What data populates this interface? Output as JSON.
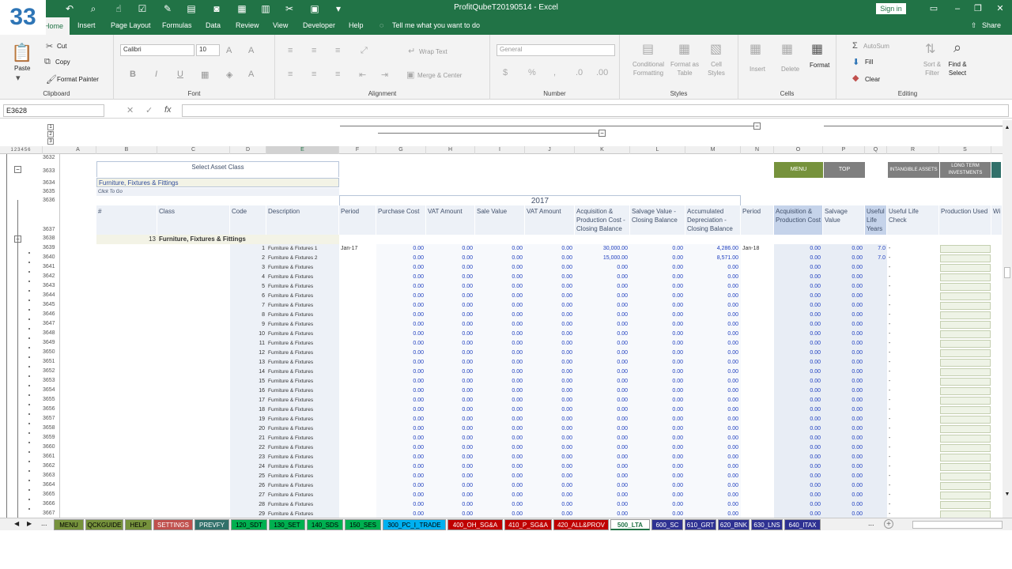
{
  "badge": "33",
  "doc_title": "ProfitQubeT20190514  -  Excel",
  "signin": "Sign in",
  "share": "Share",
  "ribbon_tabs": [
    "Home",
    "Insert",
    "Page Layout",
    "Formulas",
    "Data",
    "Review",
    "View",
    "Developer",
    "Help"
  ],
  "tell_me": "Tell me what you want to do",
  "clipboard": {
    "paste": "Paste",
    "cut": "Cut",
    "copy": "Copy",
    "format_painter": "Format Painter",
    "label": "Clipboard"
  },
  "font": {
    "name": "Calibri",
    "size": "10",
    "label": "Font"
  },
  "alignment": {
    "wrap": "Wrap Text",
    "merge": "Merge & Center",
    "label": "Alignment"
  },
  "number": {
    "format": "General",
    "label": "Number"
  },
  "styles": {
    "cond": "Conditional Formatting",
    "table": "Format as Table",
    "cell": "Cell Styles",
    "label": "Styles"
  },
  "cells": {
    "insert": "Insert",
    "delete": "Delete",
    "format": "Format",
    "label": "Cells"
  },
  "editing": {
    "autosum": "AutoSum",
    "fill": "Fill",
    "clear": "Clear",
    "sort": "Sort & Filter",
    "find": "Find & Select",
    "label": "Editing"
  },
  "namebox": "E3628",
  "fx": "fx",
  "col_headers": [
    "A",
    "B",
    "C",
    "D",
    "E",
    "F",
    "G",
    "H",
    "I",
    "J",
    "K",
    "L",
    "M",
    "N",
    "O",
    "P",
    "Q",
    "R",
    "S"
  ],
  "row_numbers": [
    "3632",
    "3633",
    "3634",
    "3635",
    "3636",
    "3637",
    "3638",
    "3639",
    "3640",
    "3641",
    "3642",
    "3643",
    "3644",
    "3645",
    "3646",
    "3647",
    "3648",
    "3649",
    "3650",
    "3651",
    "3652",
    "3653",
    "3654",
    "3655",
    "3656",
    "3657",
    "3658",
    "3659",
    "3660",
    "3661",
    "3662",
    "3663",
    "3664",
    "3665",
    "3666",
    "3667"
  ],
  "sheet": {
    "select_asset": "Select Asset Class",
    "asset_value": "Furniture, Fixtures & Fittings",
    "click_to_go": "Click To Go",
    "year": "2017",
    "menu_btn": "MENU",
    "top_btn": "TOP",
    "intangible": "INTANGIBLE ASSETS",
    "long_term": "LONG TERM INVESTMENTS",
    "headers": [
      "#",
      "Class",
      "Code",
      "Description",
      "Period",
      "Purchase Cost",
      "VAT Amount",
      "Sale Value",
      "VAT Amount",
      "Acquisition & Production Cost - Closing Balance",
      "Salvage Value - Closing Balance",
      "Accumulated Depreciation - Closing Balance",
      "Period",
      "Acquisition & Production Cost",
      "Salvage Value",
      "Useful Life Years",
      "Useful Life Check",
      "Production Used",
      "Wi"
    ],
    "class_num": "13",
    "class_name": "Furniture, Fixtures & Fittings",
    "rows": [
      {
        "n": "1",
        "d": "Furniture & Fixtures 1",
        "p": "Jan-17",
        "k": "30,000.00",
        "m": "4,286.00",
        "np": "Jan-18",
        "q": "7.0"
      },
      {
        "n": "2",
        "d": "Furniture & Fixtures 2",
        "p": "",
        "k": "15,000.00",
        "m": "8,571.00",
        "np": "",
        "q": "7.0"
      },
      {
        "n": "3",
        "d": "Furniture & Fixtures"
      },
      {
        "n": "4",
        "d": "Furniture & Fixtures"
      },
      {
        "n": "5",
        "d": "Furniture & Fixtures"
      },
      {
        "n": "6",
        "d": "Furniture & Fixtures"
      },
      {
        "n": "7",
        "d": "Furniture & Fixtures"
      },
      {
        "n": "8",
        "d": "Furniture & Fixtures"
      },
      {
        "n": "9",
        "d": "Furniture & Fixtures"
      },
      {
        "n": "10",
        "d": "Furniture & Fixtures"
      },
      {
        "n": "11",
        "d": "Furniture & Fixtures"
      },
      {
        "n": "12",
        "d": "Furniture & Fixtures"
      },
      {
        "n": "13",
        "d": "Furniture & Fixtures"
      },
      {
        "n": "14",
        "d": "Furniture & Fixtures"
      },
      {
        "n": "15",
        "d": "Furniture & Fixtures"
      },
      {
        "n": "16",
        "d": "Furniture & Fixtures"
      },
      {
        "n": "17",
        "d": "Furniture & Fixtures"
      },
      {
        "n": "18",
        "d": "Furniture & Fixtures"
      },
      {
        "n": "19",
        "d": "Furniture & Fixtures"
      },
      {
        "n": "20",
        "d": "Furniture & Fixtures"
      },
      {
        "n": "21",
        "d": "Furniture & Fixtures"
      },
      {
        "n": "22",
        "d": "Furniture & Fixtures"
      },
      {
        "n": "23",
        "d": "Furniture & Fixtures"
      },
      {
        "n": "24",
        "d": "Furniture & Fixtures"
      },
      {
        "n": "25",
        "d": "Furniture & Fixtures"
      },
      {
        "n": "26",
        "d": "Furniture & Fixtures"
      },
      {
        "n": "27",
        "d": "Furniture & Fixtures"
      },
      {
        "n": "28",
        "d": "Furniture & Fixtures"
      },
      {
        "n": "29",
        "d": "Furniture & Fixtures"
      }
    ],
    "zero": "0.00",
    "dash": "-"
  },
  "sheet_tabs": [
    {
      "label": "MENU",
      "bg": "#76923c",
      "fg": "#000"
    },
    {
      "label": "QCKGUIDE",
      "bg": "#76923c",
      "fg": "#000"
    },
    {
      "label": "HELP",
      "bg": "#76923c",
      "fg": "#000"
    },
    {
      "label": "SETTINGS",
      "bg": "#c0504d",
      "fg": "#fff"
    },
    {
      "label": "PREVFY",
      "bg": "#31706a",
      "fg": "#fff"
    },
    {
      "label": "120_SDT",
      "bg": "#00b050",
      "fg": "#000"
    },
    {
      "label": "130_SET",
      "bg": "#00b050",
      "fg": "#000"
    },
    {
      "label": "140_SDS",
      "bg": "#00b050",
      "fg": "#000"
    },
    {
      "label": "150_SES",
      "bg": "#00b050",
      "fg": "#000"
    },
    {
      "label": "300_PC_I_TRADE",
      "bg": "#00b0f0",
      "fg": "#000"
    },
    {
      "label": "400_OH_SG&A",
      "bg": "#c00000",
      "fg": "#fff"
    },
    {
      "label": "410_P_SG&A",
      "bg": "#c00000",
      "fg": "#fff"
    },
    {
      "label": "420_ALL&PROV",
      "bg": "#c00000",
      "fg": "#fff"
    },
    {
      "label": "500_LTA",
      "bg": "#ffffff",
      "fg": "#217346"
    },
    {
      "label": "600_SC",
      "bg": "#2e3192",
      "fg": "#fff"
    },
    {
      "label": "610_GRT",
      "bg": "#2e3192",
      "fg": "#fff"
    },
    {
      "label": "620_BNK",
      "bg": "#2e3192",
      "fg": "#fff"
    },
    {
      "label": "630_LNS",
      "bg": "#2e3192",
      "fg": "#fff"
    },
    {
      "label": "640_ITAX",
      "bg": "#2e3192",
      "fg": "#fff"
    }
  ],
  "more": "..."
}
